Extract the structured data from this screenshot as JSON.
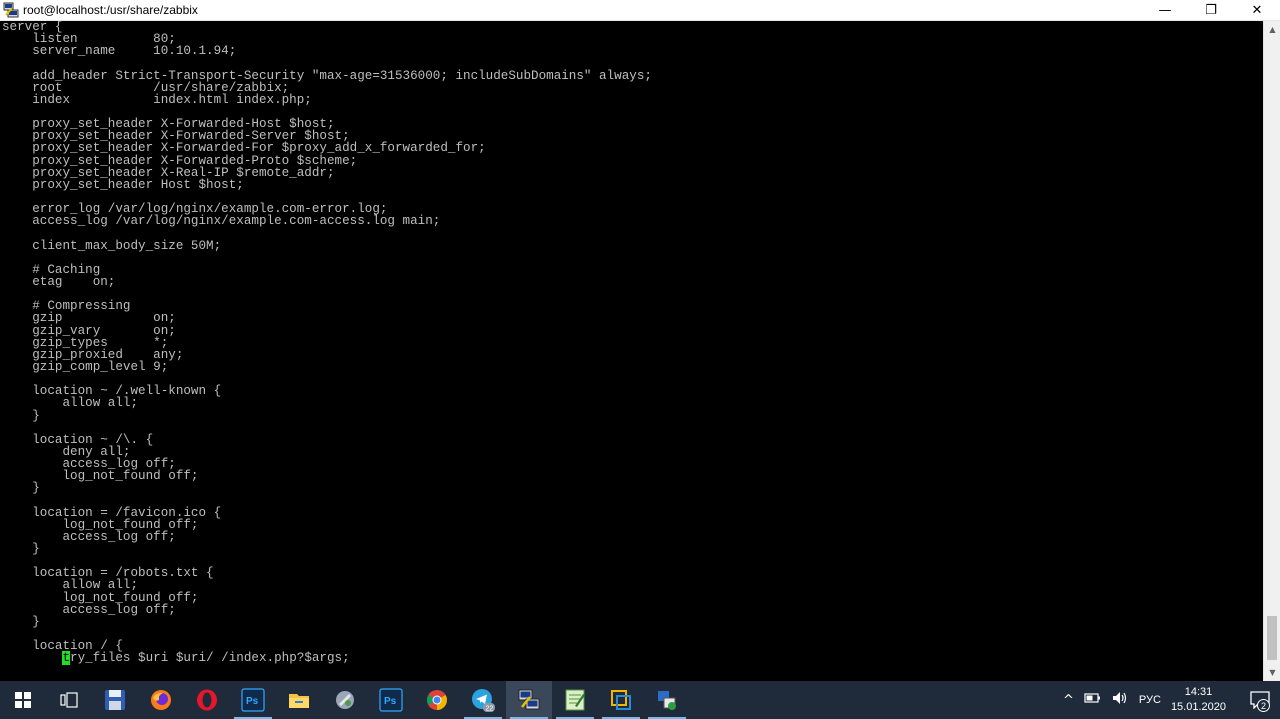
{
  "window": {
    "title": "root@localhost:/usr/share/zabbix",
    "minimize": "—",
    "restore": "❐",
    "close": "✕"
  },
  "terminal": {
    "lines": [
      "server {",
      "    listen          80;",
      "    server_name     10.10.1.94;",
      "",
      "    add_header Strict-Transport-Security \"max-age=31536000; includeSubDomains\" always;",
      "    root            /usr/share/zabbix;",
      "    index           index.html index.php;",
      "",
      "    proxy_set_header X-Forwarded-Host $host;",
      "    proxy_set_header X-Forwarded-Server $host;",
      "    proxy_set_header X-Forwarded-For $proxy_add_x_forwarded_for;",
      "    proxy_set_header X-Forwarded-Proto $scheme;",
      "    proxy_set_header X-Real-IP $remote_addr;",
      "    proxy_set_header Host $host;",
      "",
      "    error_log /var/log/nginx/example.com-error.log;",
      "    access_log /var/log/nginx/example.com-access.log main;",
      "",
      "    client_max_body_size 50M;",
      "",
      "    # Caching",
      "    etag    on;",
      "",
      "    # Compressing",
      "    gzip            on;",
      "    gzip_vary       on;",
      "    gzip_types      *;",
      "    gzip_proxied    any;",
      "    gzip_comp_level 9;",
      "",
      "    location ~ /.well-known {",
      "        allow all;",
      "    }",
      "",
      "    location ~ /\\. {",
      "        deny all;",
      "        access_log off;",
      "        log_not_found off;",
      "    }",
      "",
      "    location = /favicon.ico {",
      "        log_not_found off;",
      "        access_log off;",
      "    }",
      "",
      "    location = /robots.txt {",
      "        allow all;",
      "        log_not_found off;",
      "        access_log off;",
      "    }",
      "",
      "    location / {"
    ],
    "cursor_line": {
      "before": "        ",
      "cursor": "t",
      "after": "ry_files $uri $uri/ /index.php?$args;"
    }
  },
  "taskbar": {
    "apps": [
      "start-icon",
      "task-view-icon",
      "save-icon",
      "firefox-icon",
      "opera-icon",
      "photoshop-icon",
      "file-explorer-icon",
      "app-icon",
      "photoshop-icon",
      "chrome-icon",
      "telegram-icon",
      "putty-icon",
      "notepad-icon",
      "virtualbox-icon",
      "network-tool-icon"
    ],
    "telegram_badge": "22",
    "photoshop_label": "Ps",
    "tray_chevron": "^",
    "language": "РУС",
    "time": "14:31",
    "date": "15.01.2020",
    "notification_count": "2"
  },
  "colors": {
    "terminal_bg": "#000000",
    "terminal_fg": "#bfbfbf",
    "cursor": "#1fe01f",
    "taskbar_bg": "#1f2a3a"
  }
}
